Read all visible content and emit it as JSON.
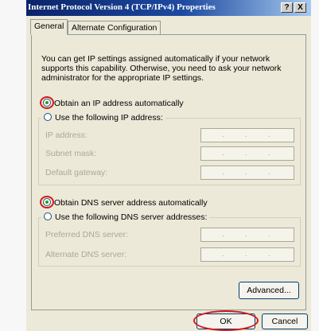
{
  "window": {
    "title": "Internet Protocol Version 4 (TCP/IPv4) Properties",
    "help_label": "?",
    "close_label": "X"
  },
  "tabs": [
    {
      "label": "General",
      "active": true
    },
    {
      "label": "Alternate Configuration",
      "active": false
    }
  ],
  "description": "You can get IP settings assigned automatically if your network supports this capability. Otherwise, you need to ask your network administrator for the appropriate IP settings.",
  "ip_section": {
    "auto_label": "Obtain an IP address automatically",
    "auto_selected": true,
    "manual_label": "Use the following IP address:",
    "fields": [
      {
        "label": "IP address:",
        "value": ". . ."
      },
      {
        "label": "Subnet mask:",
        "value": ". . ."
      },
      {
        "label": "Default gateway:",
        "value": ". . ."
      }
    ]
  },
  "dns_section": {
    "auto_label": "Obtain DNS server address automatically",
    "auto_selected": true,
    "manual_label": "Use the following DNS server addresses:",
    "fields": [
      {
        "label": "Preferred DNS server:",
        "value": ". . ."
      },
      {
        "label": "Alternate DNS server:",
        "value": ". . ."
      }
    ]
  },
  "buttons": {
    "advanced": "Advanced...",
    "ok": "OK",
    "cancel": "Cancel"
  },
  "colors": {
    "highlight": "#d21a1a",
    "titlebar": "#0a246a",
    "dialog_bg": "#ece9d8"
  }
}
